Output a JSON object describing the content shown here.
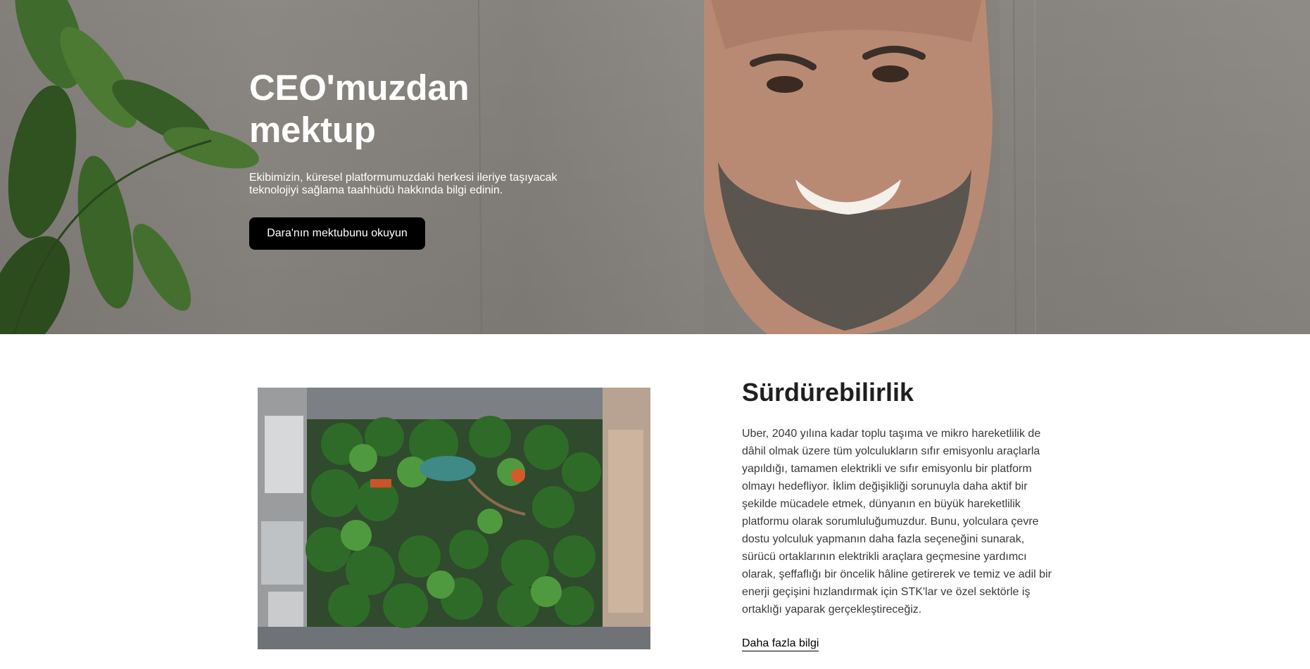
{
  "hero": {
    "title": "CEO'muzdan\nmektup",
    "description": "Ekibimizin, küresel platformumuzdaki herkesi ileriye taşıyacak teknolojiyi sağlama taahhüdü hakkında bilgi edinin.",
    "button_label": "Dara'nın mektubunu okuyun"
  },
  "sustainability": {
    "title": "Sürdürebilirlik",
    "body": "Uber, 2040 yılına kadar toplu taşıma ve mikro hareketlilik de dâhil olmak üzere tüm yolculukların sıfır emisyonlu araçlarla yapıldığı, tamamen elektrikli ve sıfır emisyonlu bir platform olmayı hedefliyor. İklim değişikliği sorunuyla daha aktif bir şekilde mücadele etmek, dünyanın en büyük hareketlilik platformu olarak sorumluluğumuzdur. Bunu, yolculara çevre dostu yolculuk yapmanın daha fazla seçeneğini sunarak, sürücü ortaklarının elektrikli araçlara geçmesine yardımcı olarak, şeffaflığı bir öncelik hâline getirerek ve temiz ve adil bir enerji geçişini hızlandırmak için STK'lar ve özel sektörle iş ortaklığı yaparak gerçekleştireceğiz.",
    "link_label": "Daha fazla bilgi"
  }
}
